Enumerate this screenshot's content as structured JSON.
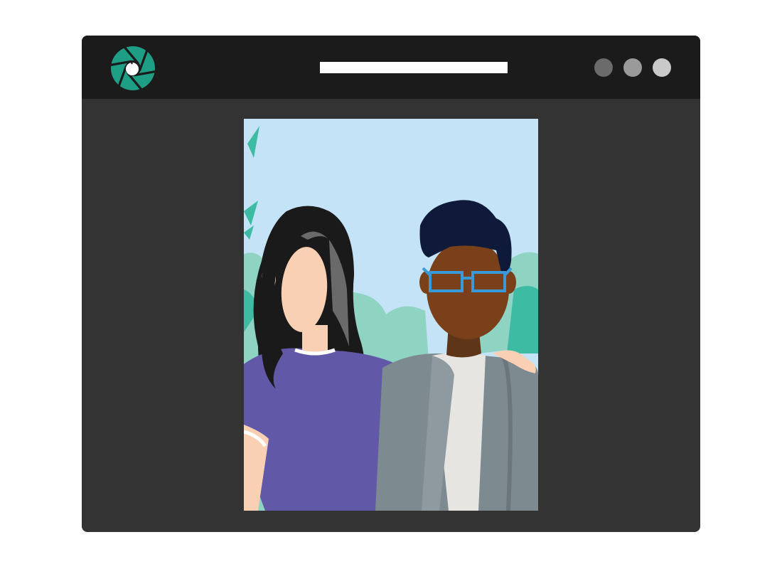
{
  "window": {
    "title_bar": {
      "logo": "camera-aperture-icon",
      "address_bar_text": "",
      "controls": [
        {
          "name": "minimize",
          "color": "#6b6b6b"
        },
        {
          "name": "maximize",
          "color": "#9a9a9a"
        },
        {
          "name": "close",
          "color": "#c9c9c9"
        }
      ]
    },
    "content": {
      "image": "photo-two-people-portrait"
    }
  },
  "colors": {
    "accent": "#1f9e86",
    "window_body": "#333333",
    "title_bar": "#1b1b1b",
    "sky": "#c4e3f6"
  }
}
